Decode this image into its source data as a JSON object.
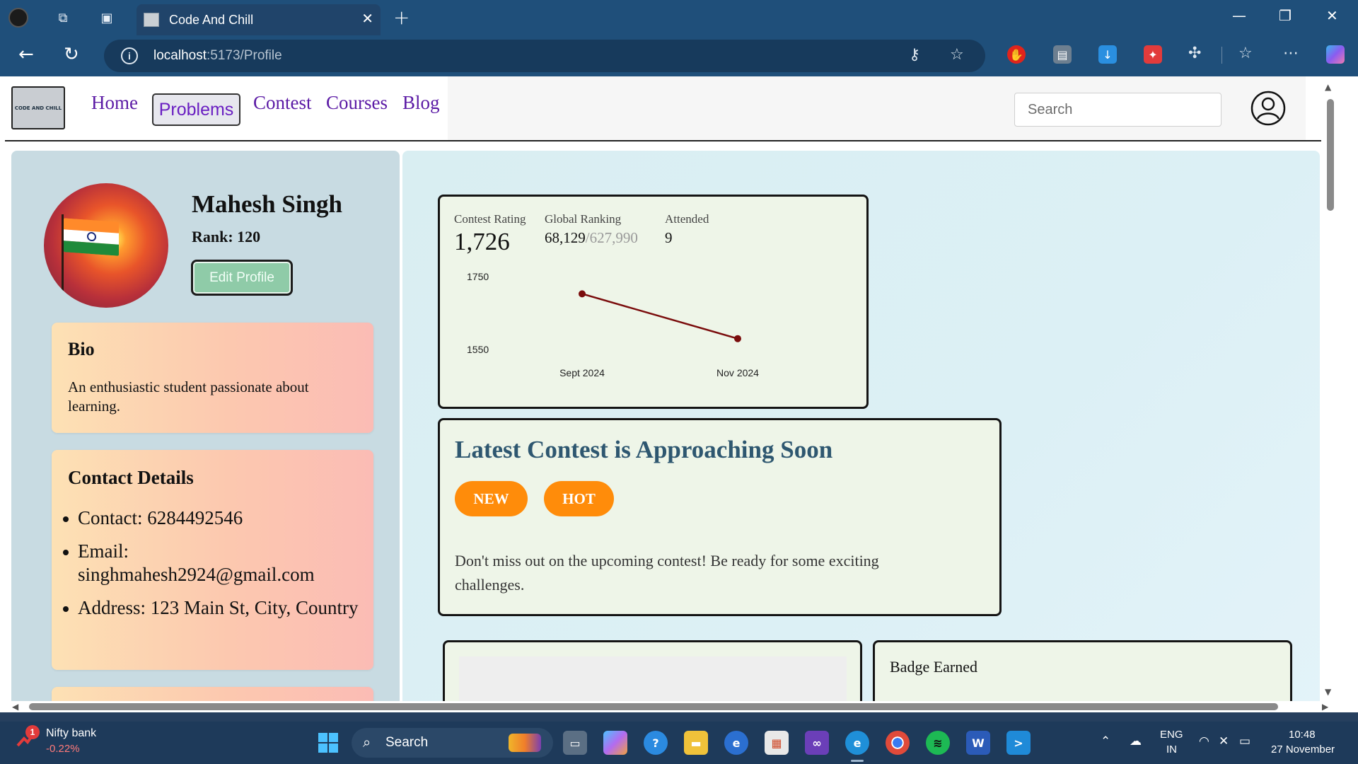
{
  "browser": {
    "tab_title": "Code And Chill",
    "tab_close": "✕",
    "new_tab": "+",
    "url_host": "localhost",
    "url_path": ":5173/Profile",
    "info_icon": "i"
  },
  "site": {
    "logo_text": "CODE AND CHILL",
    "nav": {
      "home": "Home",
      "problems": "Problems",
      "contest": "Contest",
      "courses": "Courses",
      "blog": "Blog"
    },
    "search_placeholder": "Search"
  },
  "profile": {
    "name": "Mahesh Singh",
    "rank": "Rank: 120",
    "edit_button": "Edit Profile",
    "bio_title": "Bio",
    "bio_text": "An enthusiastic student passionate about learning.",
    "contact_title": "Contact Details",
    "contact": [
      "Contact: 6284492546",
      "Email: singhmahesh2924@gmail.com",
      "Address: 123 Main St, City, Country"
    ]
  },
  "stats": {
    "rating_label": "Contest Rating",
    "rating_value": "1,726",
    "global_label": "Global Ranking",
    "global_value": "68,129",
    "global_total": "/627,990",
    "attended_label": "Attended",
    "attended_value": "9"
  },
  "chart_data": {
    "type": "line",
    "x": [
      "Sept 2024",
      "Nov 2024"
    ],
    "series": [
      {
        "values": [
          1726,
          1603
        ]
      }
    ],
    "y_ticks": [
      1750,
      1550
    ],
    "x_ticks": [
      "Sept 2024",
      "Nov 2024"
    ],
    "ylim": [
      1550,
      1750
    ],
    "line_color": "#7a0c0c",
    "grid": false
  },
  "contest": {
    "title": "Latest Contest is Approaching Soon",
    "tag_new": "NEW",
    "tag_hot": "HOT",
    "text": "Don't miss out on the upcoming contest! Be ready for some exciting challenges."
  },
  "badges": {
    "title": "Badge Earned"
  },
  "taskbar": {
    "widget_badge": "1",
    "widget_title": "Nifty bank",
    "widget_value": "-0.22%",
    "search_label": "Search",
    "lang": "ENG",
    "region": "IN",
    "time": "10:48",
    "date": "27 November"
  },
  "colors": {
    "browser_chrome": "#1f4f7a",
    "left_panel": "#c8dbe2",
    "card_gradient_start": "#fde1b4",
    "card_gradient_end": "#fbbcb5",
    "stat_card_bg": "#eef5e8",
    "contest_title": "#2e5770",
    "pill": "#ff8c0a",
    "nav_link": "#5b1aa5",
    "edit_button": "#8fcba8"
  }
}
